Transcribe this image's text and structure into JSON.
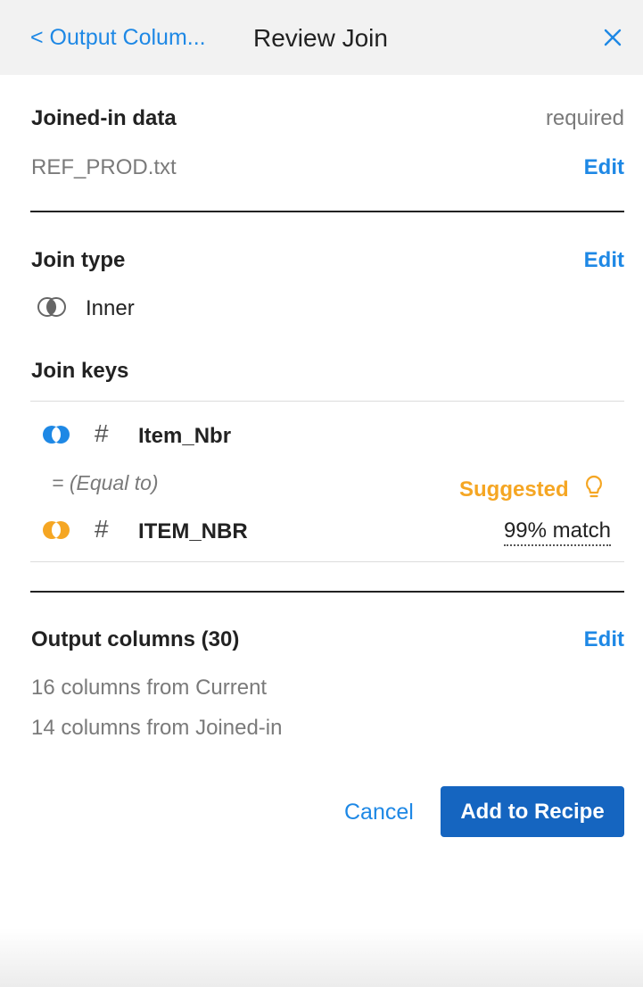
{
  "header": {
    "back_label": "< Output Colum...",
    "title": "Review Join",
    "close_icon": "close-icon"
  },
  "joined_in": {
    "label": "Joined-in data",
    "required_label": "required",
    "file": "REF_PROD.txt",
    "edit_label": "Edit"
  },
  "join_type": {
    "label": "Join type",
    "edit_label": "Edit",
    "value": "Inner",
    "icon": "inner-join-icon"
  },
  "join_keys": {
    "label": "Join keys",
    "current_key": "Item_Nbr",
    "operator": "= (Equal to)",
    "suggested_label": "Suggested",
    "joined_key": "ITEM_NBR",
    "match_label": "99% match",
    "colors": {
      "current": "#1e88e5",
      "joined": "#f5a623"
    }
  },
  "output_columns": {
    "label": "Output columns (30)",
    "edit_label": "Edit",
    "from_current": "16 columns from Current",
    "from_joined": "14 columns from Joined-in"
  },
  "actions": {
    "cancel_label": "Cancel",
    "add_label": "Add to Recipe"
  },
  "colors": {
    "accent": "#1e88e5",
    "primary_button": "#1565c0",
    "suggested": "#f5a623"
  }
}
